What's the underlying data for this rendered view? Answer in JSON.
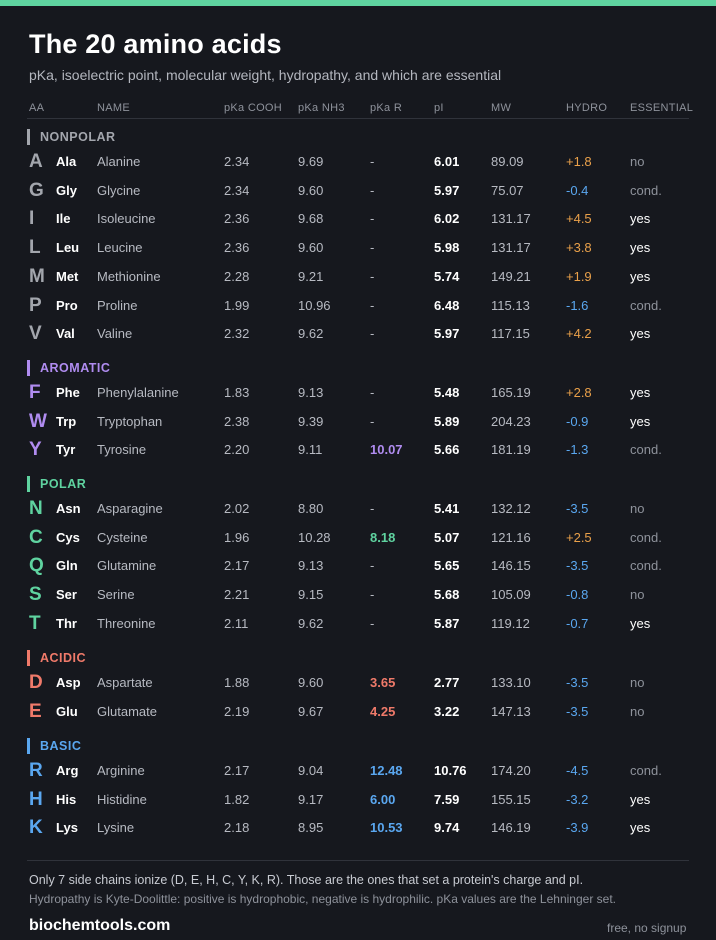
{
  "title": "The 20 amino acids",
  "subtitle": "pKa, isoelectric point, molecular weight, hydropathy, and which are essential",
  "headers": [
    "AA",
    "NAME",
    "pKa COOH",
    "pKa NH3",
    "pKa R",
    "pI",
    "MW",
    "HYDRO",
    "ESSENTIAL"
  ],
  "colors": {
    "nonpolar": "#a3a6ad",
    "aromatic": "#b08cf0",
    "polar": "#5fd3a0",
    "acidic": "#f07a6a",
    "basic": "#5aa7f0",
    "hydro_positive": "#e9a04a",
    "hydro_negative": "#5aa7f0",
    "essential_yes": "#ffffff",
    "essential_other": "#8e929b"
  },
  "groups": [
    {
      "label": "NONPOLAR",
      "key": "nonpolar",
      "rows": [
        {
          "letter": "A",
          "abbr": "Ala",
          "name": "Alanine",
          "cooh": "2.34",
          "nh3": "9.69",
          "pkr": "-",
          "pi": "6.01",
          "mw": "89.09",
          "hydro": "+1.8",
          "ess": "no"
        },
        {
          "letter": "G",
          "abbr": "Gly",
          "name": "Glycine",
          "cooh": "2.34",
          "nh3": "9.60",
          "pkr": "-",
          "pi": "5.97",
          "mw": "75.07",
          "hydro": "-0.4",
          "ess": "cond."
        },
        {
          "letter": "I",
          "abbr": "Ile",
          "name": "Isoleucine",
          "cooh": "2.36",
          "nh3": "9.68",
          "pkr": "-",
          "pi": "6.02",
          "mw": "131.17",
          "hydro": "+4.5",
          "ess": "yes"
        },
        {
          "letter": "L",
          "abbr": "Leu",
          "name": "Leucine",
          "cooh": "2.36",
          "nh3": "9.60",
          "pkr": "-",
          "pi": "5.98",
          "mw": "131.17",
          "hydro": "+3.8",
          "ess": "yes"
        },
        {
          "letter": "M",
          "abbr": "Met",
          "name": "Methionine",
          "cooh": "2.28",
          "nh3": "9.21",
          "pkr": "-",
          "pi": "5.74",
          "mw": "149.21",
          "hydro": "+1.9",
          "ess": "yes"
        },
        {
          "letter": "P",
          "abbr": "Pro",
          "name": "Proline",
          "cooh": "1.99",
          "nh3": "10.96",
          "pkr": "-",
          "pi": "6.48",
          "mw": "115.13",
          "hydro": "-1.6",
          "ess": "cond."
        },
        {
          "letter": "V",
          "abbr": "Val",
          "name": "Valine",
          "cooh": "2.32",
          "nh3": "9.62",
          "pkr": "-",
          "pi": "5.97",
          "mw": "117.15",
          "hydro": "+4.2",
          "ess": "yes"
        }
      ]
    },
    {
      "label": "AROMATIC",
      "key": "aromatic",
      "rows": [
        {
          "letter": "F",
          "abbr": "Phe",
          "name": "Phenylalanine",
          "cooh": "1.83",
          "nh3": "9.13",
          "pkr": "-",
          "pi": "5.48",
          "mw": "165.19",
          "hydro": "+2.8",
          "ess": "yes"
        },
        {
          "letter": "W",
          "abbr": "Trp",
          "name": "Tryptophan",
          "cooh": "2.38",
          "nh3": "9.39",
          "pkr": "-",
          "pi": "5.89",
          "mw": "204.23",
          "hydro": "-0.9",
          "ess": "yes"
        },
        {
          "letter": "Y",
          "abbr": "Tyr",
          "name": "Tyrosine",
          "cooh": "2.20",
          "nh3": "9.11",
          "pkr": "10.07",
          "pi": "5.66",
          "mw": "181.19",
          "hydro": "-1.3",
          "ess": "cond."
        }
      ]
    },
    {
      "label": "POLAR",
      "key": "polar",
      "rows": [
        {
          "letter": "N",
          "abbr": "Asn",
          "name": "Asparagine",
          "cooh": "2.02",
          "nh3": "8.80",
          "pkr": "-",
          "pi": "5.41",
          "mw": "132.12",
          "hydro": "-3.5",
          "ess": "no"
        },
        {
          "letter": "C",
          "abbr": "Cys",
          "name": "Cysteine",
          "cooh": "1.96",
          "nh3": "10.28",
          "pkr": "8.18",
          "pi": "5.07",
          "mw": "121.16",
          "hydro": "+2.5",
          "ess": "cond."
        },
        {
          "letter": "Q",
          "abbr": "Gln",
          "name": "Glutamine",
          "cooh": "2.17",
          "nh3": "9.13",
          "pkr": "-",
          "pi": "5.65",
          "mw": "146.15",
          "hydro": "-3.5",
          "ess": "cond."
        },
        {
          "letter": "S",
          "abbr": "Ser",
          "name": "Serine",
          "cooh": "2.21",
          "nh3": "9.15",
          "pkr": "-",
          "pi": "5.68",
          "mw": "105.09",
          "hydro": "-0.8",
          "ess": "no"
        },
        {
          "letter": "T",
          "abbr": "Thr",
          "name": "Threonine",
          "cooh": "2.11",
          "nh3": "9.62",
          "pkr": "-",
          "pi": "5.87",
          "mw": "119.12",
          "hydro": "-0.7",
          "ess": "yes"
        }
      ]
    },
    {
      "label": "ACIDIC",
      "key": "acidic",
      "rows": [
        {
          "letter": "D",
          "abbr": "Asp",
          "name": "Aspartate",
          "cooh": "1.88",
          "nh3": "9.60",
          "pkr": "3.65",
          "pi": "2.77",
          "mw": "133.10",
          "hydro": "-3.5",
          "ess": "no"
        },
        {
          "letter": "E",
          "abbr": "Glu",
          "name": "Glutamate",
          "cooh": "2.19",
          "nh3": "9.67",
          "pkr": "4.25",
          "pi": "3.22",
          "mw": "147.13",
          "hydro": "-3.5",
          "ess": "no"
        }
      ]
    },
    {
      "label": "BASIC",
      "key": "basic",
      "rows": [
        {
          "letter": "R",
          "abbr": "Arg",
          "name": "Arginine",
          "cooh": "2.17",
          "nh3": "9.04",
          "pkr": "12.48",
          "pi": "10.76",
          "mw": "174.20",
          "hydro": "-4.5",
          "ess": "cond."
        },
        {
          "letter": "H",
          "abbr": "His",
          "name": "Histidine",
          "cooh": "1.82",
          "nh3": "9.17",
          "pkr": "6.00",
          "pi": "7.59",
          "mw": "155.15",
          "hydro": "-3.2",
          "ess": "yes"
        },
        {
          "letter": "K",
          "abbr": "Lys",
          "name": "Lysine",
          "cooh": "2.18",
          "nh3": "8.95",
          "pkr": "10.53",
          "pi": "9.74",
          "mw": "146.19",
          "hydro": "-3.9",
          "ess": "yes"
        }
      ]
    }
  ],
  "footnote1": "Only 7 side chains ionize (D, E, H, C, Y, K, R). Those are the ones that set a protein's charge and pI.",
  "footnote2": "Hydropathy is Kyte-Doolittle: positive is hydrophobic, negative is hydrophilic. pKa values are the Lehninger set.",
  "brand": "biochemtools.com",
  "tagline": "free, no signup"
}
